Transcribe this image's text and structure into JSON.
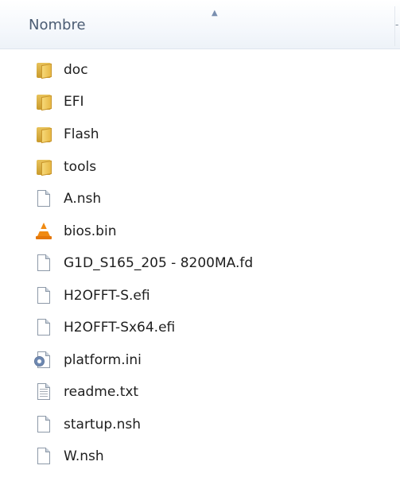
{
  "header": {
    "column_name": "Nombre",
    "sort_arrow": "▲",
    "divider_mark": "-"
  },
  "files": [
    {
      "name": "doc",
      "icon": "folder-icon"
    },
    {
      "name": "EFI",
      "icon": "folder-icon"
    },
    {
      "name": "Flash",
      "icon": "folder-icon"
    },
    {
      "name": "tools",
      "icon": "folder-icon"
    },
    {
      "name": "A.nsh",
      "icon": "file-icon"
    },
    {
      "name": "bios.bin",
      "icon": "vlc-cone-icon"
    },
    {
      "name": "G1D_S165_205 - 8200MA.fd",
      "icon": "file-icon"
    },
    {
      "name": "H2OFFT-S.efi",
      "icon": "file-icon"
    },
    {
      "name": "H2OFFT-Sx64.efi",
      "icon": "file-icon"
    },
    {
      "name": "platform.ini",
      "icon": "settings-file-icon"
    },
    {
      "name": "readme.txt",
      "icon": "text-file-icon"
    },
    {
      "name": "startup.nsh",
      "icon": "file-icon"
    },
    {
      "name": "W.nsh",
      "icon": "file-icon"
    }
  ]
}
